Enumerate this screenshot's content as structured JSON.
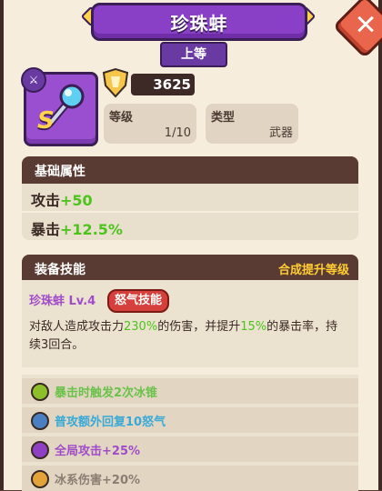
{
  "header": {
    "title": "珍珠蚌",
    "rank": "上等",
    "close_label": "✕"
  },
  "item": {
    "tag": "⚔",
    "letter": "S",
    "power": "3625"
  },
  "stats": [
    {
      "label": "等级",
      "value": "1/10"
    },
    {
      "label": "类型",
      "value": "武器"
    }
  ],
  "basic": {
    "title": "基础属性",
    "attrs": [
      {
        "name": "攻击",
        "value": "+50"
      },
      {
        "name": "暴击",
        "value": "+12.5%"
      }
    ]
  },
  "skill": {
    "title": "装备技能",
    "action": "合成提升等级",
    "name": "珍珠蚌 Lv.4",
    "tag": "怒气技能",
    "desc_1": "对敌人造成攻击力",
    "desc_hl_1": "230%",
    "desc_2": "的伤害，并提升",
    "desc_hl_2": "15%",
    "desc_3": "的暴击率，持续3回合。"
  },
  "perks": [
    {
      "text": "暴击时触发2次冰锥",
      "color": "#6ac24a",
      "dot": "#8cbf2a"
    },
    {
      "text": "普攻额外回复10怒气",
      "color": "#3aa9d6",
      "dot": "#4a7fc4"
    },
    {
      "text": "全局攻击+25%",
      "color": "#a04cc8",
      "dot": "#8e3fc4"
    },
    {
      "text": "冰系伤害+20%",
      "color": "#8a7d72",
      "dot": "#e4a23a"
    }
  ]
}
